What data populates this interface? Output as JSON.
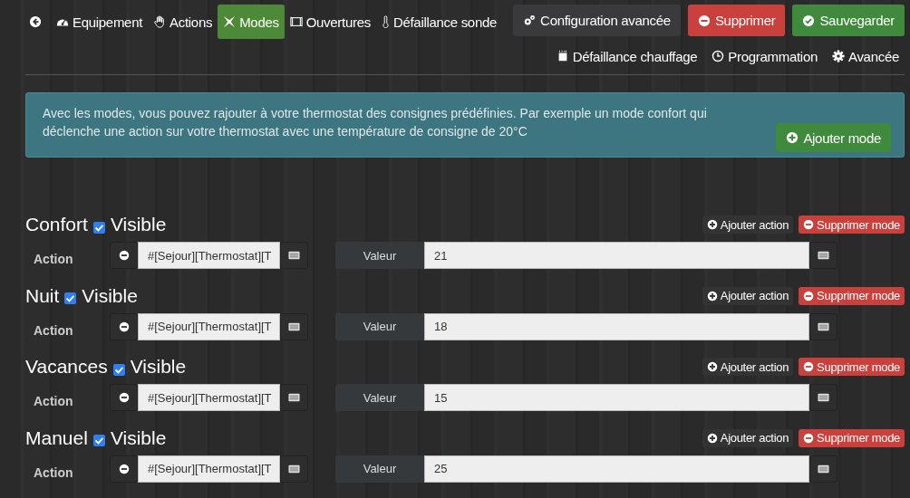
{
  "nav": {
    "tabs": [
      {
        "label": "Equipement",
        "selected": false
      },
      {
        "label": "Actions",
        "selected": false
      },
      {
        "label": "Modes",
        "selected": true
      },
      {
        "label": "Ouvertures",
        "selected": false
      },
      {
        "label": "Défaillance sonde",
        "selected": false
      }
    ],
    "buttons": [
      {
        "label": "Configuration avancée",
        "kind": "default"
      },
      {
        "label": "Supprimer",
        "kind": "danger"
      },
      {
        "label": "Sauvegarder",
        "kind": "success"
      }
    ],
    "more_tabs": [
      {
        "label": "Défaillance chauffage",
        "selected": false
      },
      {
        "label": "Programmation",
        "selected": false
      },
      {
        "label": "Avancée",
        "selected": false
      }
    ]
  },
  "alert": {
    "text": "Avec les modes, vous pouvez rajouter à votre thermostat des consignes prédéfinies. Par exemple un mode confort qui déclenche une action sur votre thermostat avec une température de consigne de 20°C",
    "button": "Ajouter mode"
  },
  "modes": [
    {
      "name": "Confort",
      "visible": true,
      "visible_label": "Visible",
      "add_action": "Ajouter action",
      "remove_mode": "Supprimer mode",
      "actions": [
        {
          "label": "Action",
          "command": "#[Sejour][Thermostat][T",
          "value_label": "Valeur",
          "value": "21"
        }
      ]
    },
    {
      "name": "Nuit",
      "visible": true,
      "visible_label": "Visible",
      "add_action": "Ajouter action",
      "remove_mode": "Supprimer mode",
      "actions": [
        {
          "label": "Action",
          "command": "#[Sejour][Thermostat][T",
          "value_label": "Valeur",
          "value": "18"
        }
      ]
    },
    {
      "name": "Vacances",
      "visible": true,
      "visible_label": "Visible",
      "add_action": "Ajouter action",
      "remove_mode": "Supprimer mode",
      "actions": [
        {
          "label": "Action",
          "command": "#[Sejour][Thermostat][T",
          "value_label": "Valeur",
          "value": "15"
        }
      ]
    },
    {
      "name": "Manuel",
      "visible": true,
      "visible_label": "Visible",
      "add_action": "Ajouter action",
      "remove_mode": "Supprimer mode",
      "actions": [
        {
          "label": "Action",
          "command": "#[Sejour][Thermostat][T",
          "value_label": "Valeur",
          "value": "25"
        }
      ]
    }
  ]
}
